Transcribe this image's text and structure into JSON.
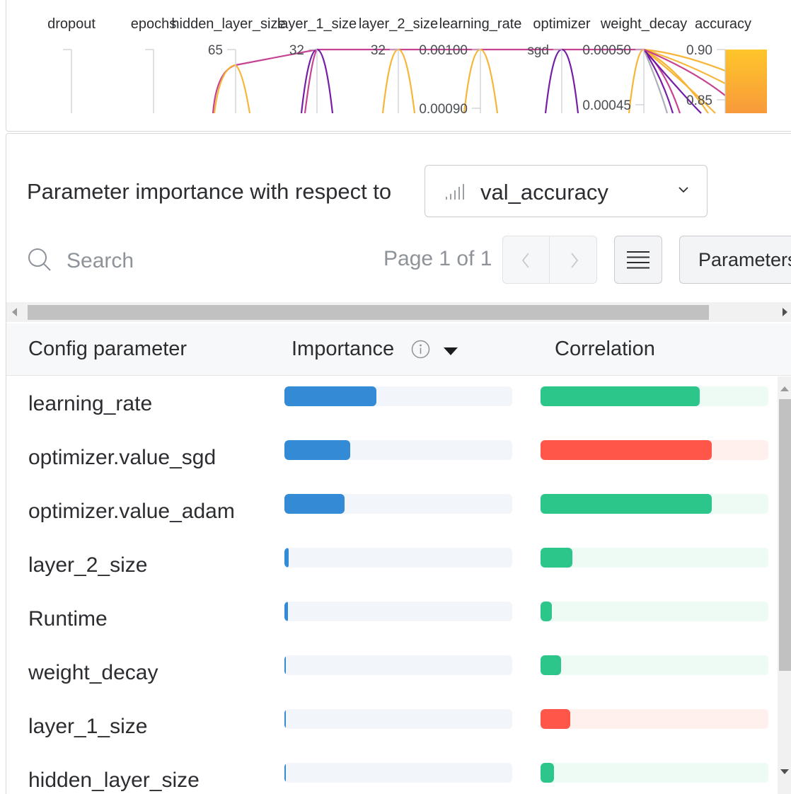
{
  "parallel_coords": {
    "axes": [
      {
        "name": "dropout",
        "ticks": []
      },
      {
        "name": "epochs",
        "ticks": []
      },
      {
        "name": "hidden_layer_size",
        "ticks": [
          "65"
        ]
      },
      {
        "name": "layer_1_size",
        "ticks": [
          "32"
        ]
      },
      {
        "name": "layer_2_size",
        "ticks": [
          "32"
        ]
      },
      {
        "name": "learning_rate",
        "ticks": [
          "0.00100",
          "0.00090"
        ]
      },
      {
        "name": "optimizer",
        "ticks": [
          "sgd"
        ]
      },
      {
        "name": "weight_decay",
        "ticks": [
          "0.00050",
          "0.00045"
        ]
      },
      {
        "name": "accuracy",
        "ticks": [
          "0.90",
          "0.85"
        ]
      }
    ],
    "colors": {
      "high": "#f7b22e",
      "mid": "#c2398c",
      "low": "#6f12a0",
      "axis": "#c9ccd0"
    }
  },
  "importance": {
    "title": "Parameter importance with respect to",
    "metric": "val_accuracy",
    "metric_icon": "bar-chart-icon",
    "search_placeholder": "Search",
    "page_info": "Page 1 of 1",
    "parameters_button": "Parameters",
    "columns": {
      "param": "Config parameter",
      "importance": "Importance",
      "correlation": "Correlation"
    },
    "colors": {
      "importance": "#338bd6",
      "importance_track": "#f2f6fb",
      "positive": "#2cc68a",
      "positive_track": "#eefaf4",
      "negative": "#ff564a",
      "negative_track": "#fff0ee"
    },
    "rows": [
      {
        "name": "learning_rate",
        "importance": 0.405,
        "correlation": 0.7
      },
      {
        "name": "optimizer.value_sgd",
        "importance": 0.29,
        "correlation": -0.75
      },
      {
        "name": "optimizer.value_adam",
        "importance": 0.265,
        "correlation": 0.75
      },
      {
        "name": "layer_2_size",
        "importance": 0.02,
        "correlation": 0.14
      },
      {
        "name": "Runtime",
        "importance": 0.015,
        "correlation": 0.05
      },
      {
        "name": "weight_decay",
        "importance": 0.005,
        "correlation": 0.09
      },
      {
        "name": "layer_1_size",
        "importance": 0.005,
        "correlation": -0.13
      },
      {
        "name": "hidden_layer_size",
        "importance": 0.005,
        "correlation": 0.06
      }
    ]
  }
}
